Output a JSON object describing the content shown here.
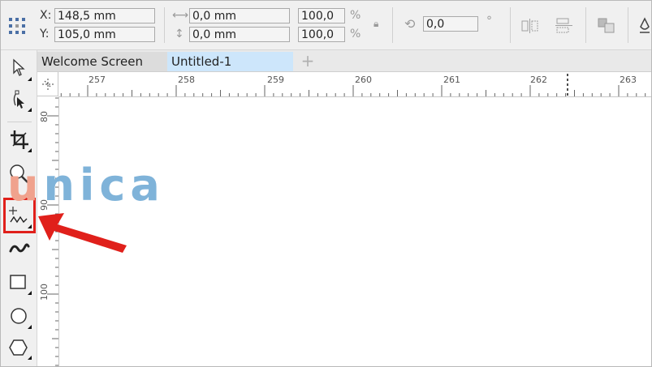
{
  "property_bar": {
    "x_label": "X:",
    "x_value": "148,5 mm",
    "y_label": "Y:",
    "y_value": "105,0 mm",
    "width_value": "0,0 mm",
    "height_value": "0,0 mm",
    "scale_x": "100,0",
    "scale_y": "100,0",
    "percent": "%",
    "rotation_value": "0,0",
    "degree": "°"
  },
  "tabs": [
    {
      "label": "Welcome Screen"
    },
    {
      "label": "Untitled-1"
    }
  ],
  "tab_add": "+",
  "ruler": {
    "h_numbers": [
      "257",
      "258",
      "259",
      "260",
      "261",
      "262",
      "263"
    ],
    "v_numbers": [
      "80",
      "90",
      "100"
    ]
  },
  "watermark": {
    "first": "u",
    "rest": "nica"
  },
  "toolbox": {
    "tools": [
      "pick-tool-icon",
      "shape-tool-icon",
      "crop-tool-icon",
      "zoom-tool-icon",
      "freehand-tool-icon",
      "artistic-media-tool-icon",
      "rectangle-tool-icon",
      "ellipse-tool-icon",
      "polygon-tool-icon"
    ],
    "highlight_color": "#e0201b"
  },
  "colors": {
    "active_tab": "#cde6fb",
    "arrow": "#e0201b",
    "watermark_orange": "#f0a28d",
    "watermark_blue": "#7fb3d9"
  }
}
